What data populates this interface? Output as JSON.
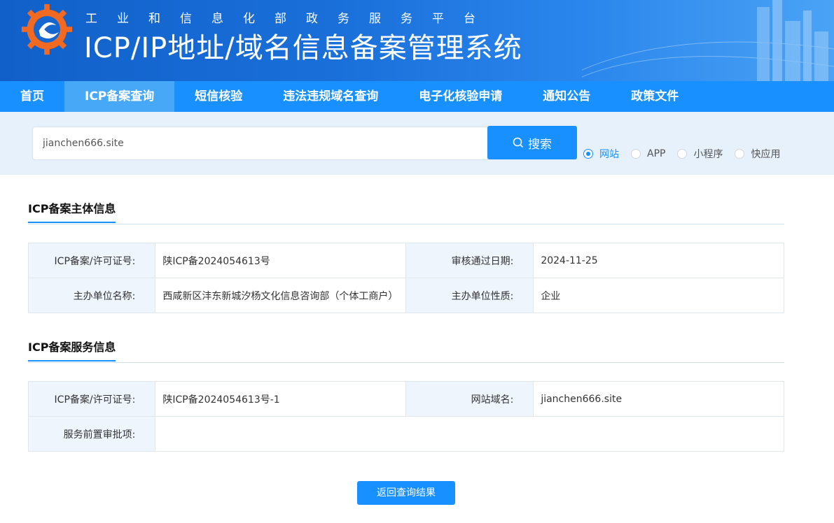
{
  "header": {
    "subtitle": "工业和信息化部政务服务平台",
    "title": "ICP/IP地址/域名信息备案管理系统"
  },
  "nav": {
    "items": [
      {
        "label": "首页"
      },
      {
        "label": "ICP备案查询"
      },
      {
        "label": "短信核验"
      },
      {
        "label": "违法违规域名查询"
      },
      {
        "label": "电子化核验申请"
      },
      {
        "label": "通知公告"
      },
      {
        "label": "政策文件"
      }
    ],
    "active": "ICP备案查询"
  },
  "search": {
    "value": "jianchen666.site",
    "button_label": "搜索",
    "options": [
      "网站",
      "APP",
      "小程序",
      "快应用"
    ],
    "selected": "网站"
  },
  "subject_section": {
    "title": "ICP备案主体信息",
    "license_label": "ICP备案/许可证号:",
    "license_value": "陕ICP备2024054613号",
    "approval_date_label": "审核通过日期:",
    "approval_date_value": "2024-11-25",
    "org_name_label": "主办单位名称:",
    "org_name_value": "西咸新区沣东新城汐杨文化信息咨询部（个体工商户）",
    "org_type_label": "主办单位性质:",
    "org_type_value": "企业"
  },
  "service_section": {
    "title": "ICP备案服务信息",
    "license_label": "ICP备案/许可证号:",
    "license_value": "陕ICP备2024054613号-1",
    "domain_label": "网站域名:",
    "domain_value": "jianchen666.site",
    "pre_approval_label": "服务前置审批项:",
    "pre_approval_value": ""
  },
  "back_button_label": "返回查询结果",
  "colors": {
    "primary": "#1890ff",
    "nav_active": "#48a8f8",
    "search_bg": "#e7f1fc",
    "label_cell_bg": "#eef5fc"
  }
}
